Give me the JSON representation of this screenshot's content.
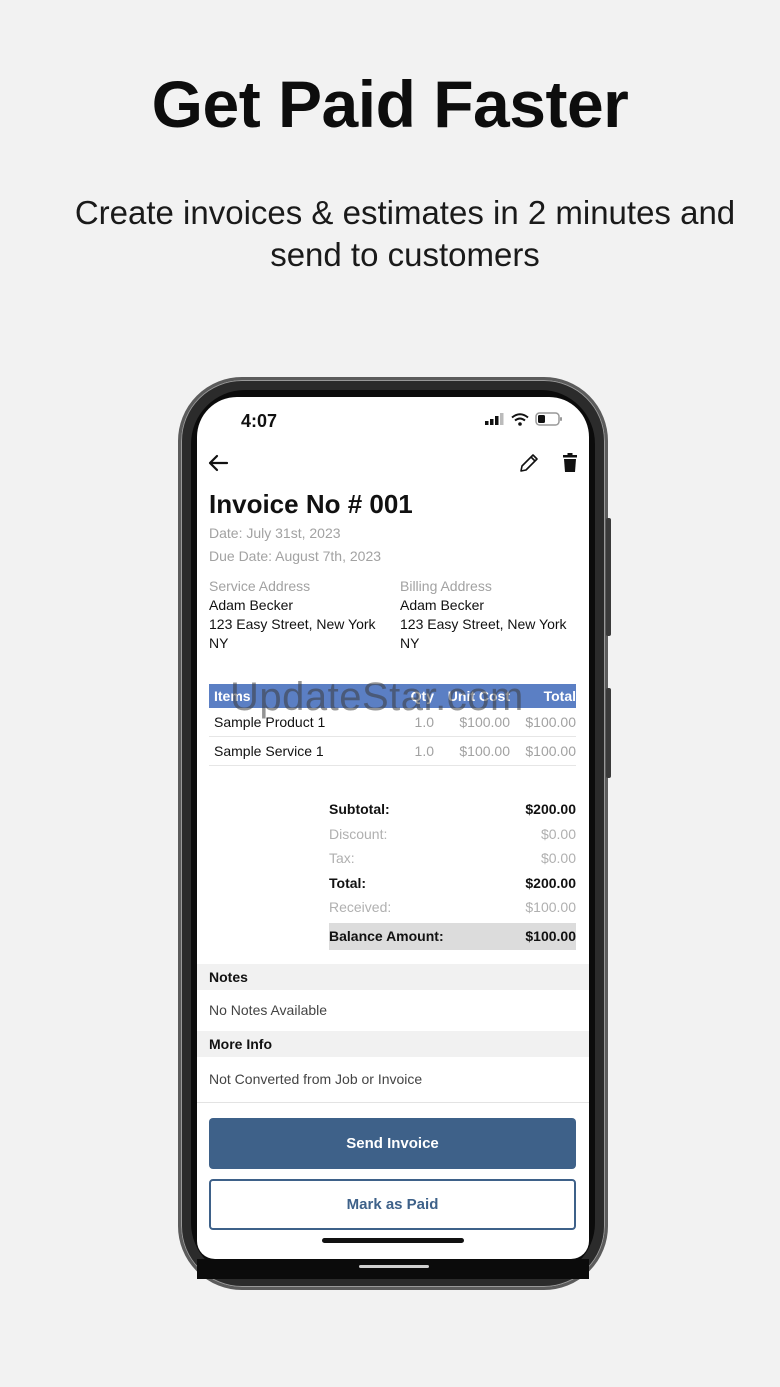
{
  "promo": {
    "headline": "Get Paid Faster",
    "subline": "Create invoices & estimates in 2 minutes and send to customers"
  },
  "status_bar": {
    "time": "4:07"
  },
  "invoice": {
    "title": "Invoice No # 001",
    "date": "Date: July 31st, 2023",
    "due_date": "Due Date: August 7th, 2023",
    "service_address": {
      "label": "Service Address",
      "name": "Adam Becker",
      "line1": "123 Easy Street, New York",
      "line2": "NY"
    },
    "billing_address": {
      "label": "Billing Address",
      "name": "Adam Becker",
      "line1": "123 Easy Street, New York",
      "line2": "NY"
    },
    "table": {
      "headers": [
        "Items",
        "Qty",
        "Unit Cost",
        "Total"
      ],
      "rows": [
        [
          "Sample Product 1",
          "1.0",
          "$100.00",
          "$100.00"
        ],
        [
          "Sample Service 1",
          "1.0",
          "$100.00",
          "$100.00"
        ]
      ]
    },
    "totals": {
      "subtotal_label": "Subtotal:",
      "subtotal": "$200.00",
      "discount_label": "Discount:",
      "discount": "$0.00",
      "tax_label": "Tax:",
      "tax": "$0.00",
      "total_label": "Total:",
      "total": "$200.00",
      "received_label": "Received:",
      "received": "$100.00",
      "balance_label": "Balance Amount:",
      "balance": "$100.00"
    },
    "notes": {
      "heading": "Notes",
      "text": "No Notes Available"
    },
    "more_info": {
      "heading": "More Info",
      "text": "Not Converted from Job or Invoice"
    }
  },
  "actions": {
    "send_label": "Send Invoice",
    "paid_label": "Mark as Paid"
  },
  "watermark": "UpdateStar.com",
  "icons": {
    "back": "arrow-left-icon",
    "edit": "pencil-icon",
    "delete": "trash-icon",
    "signal": "signal-icon",
    "wifi": "wifi-icon",
    "battery": "battery-icon"
  },
  "colors": {
    "table_header": "#5b7fc4",
    "primary_button": "#3e6189"
  }
}
